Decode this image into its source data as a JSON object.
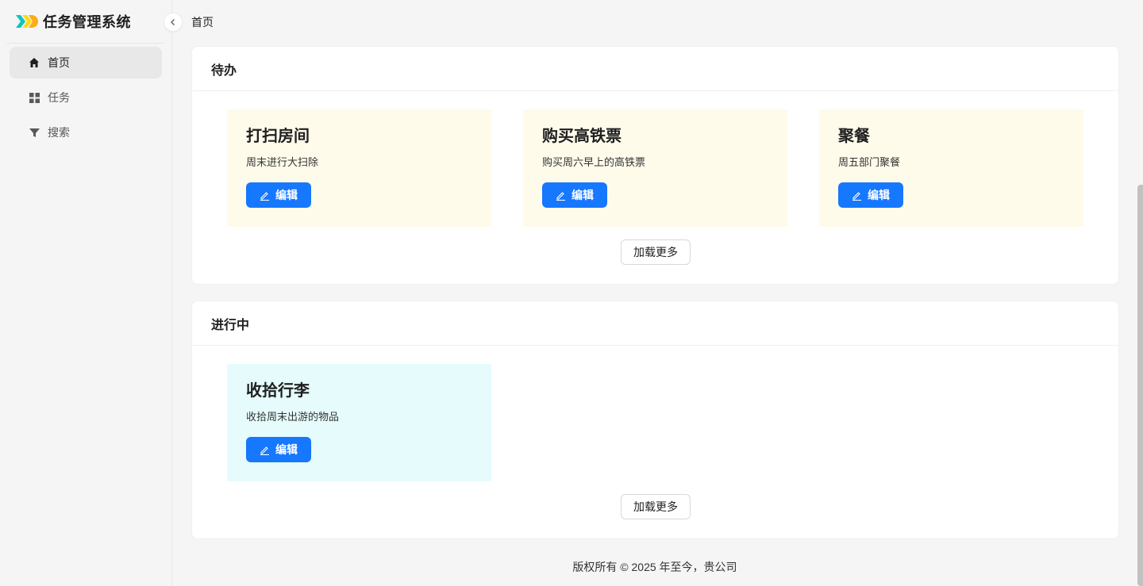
{
  "app": {
    "title": "任务管理系统"
  },
  "sidebar": {
    "items": [
      {
        "label": "首页",
        "icon": "home-icon",
        "active": true
      },
      {
        "label": "任务",
        "icon": "grid-icon",
        "active": false
      },
      {
        "label": "搜索",
        "icon": "filter-icon",
        "active": false
      }
    ]
  },
  "breadcrumb": {
    "current": "首页"
  },
  "todo": {
    "title": "待办",
    "tasks": [
      {
        "title": "打扫房间",
        "desc": "周末进行大扫除",
        "edit_label": "编辑"
      },
      {
        "title": "购买高铁票",
        "desc": "购买周六早上的高铁票",
        "edit_label": "编辑"
      },
      {
        "title": "聚餐",
        "desc": "周五部门聚餐",
        "edit_label": "编辑"
      }
    ],
    "load_more_label": "加载更多"
  },
  "in_progress": {
    "title": "进行中",
    "tasks": [
      {
        "title": "收拾行李",
        "desc": "收拾周末出游的物品",
        "edit_label": "编辑"
      }
    ],
    "load_more_label": "加载更多"
  },
  "footer": {
    "text": "版权所有 © 2025 年至今，贵公司"
  },
  "colors": {
    "primary": "#1677ff",
    "todo_card_bg": "#fffbeb",
    "doing_card_bg": "#e6fcfc",
    "logo_cyan": "#13c2c2",
    "logo_yellow": "#faad14"
  }
}
